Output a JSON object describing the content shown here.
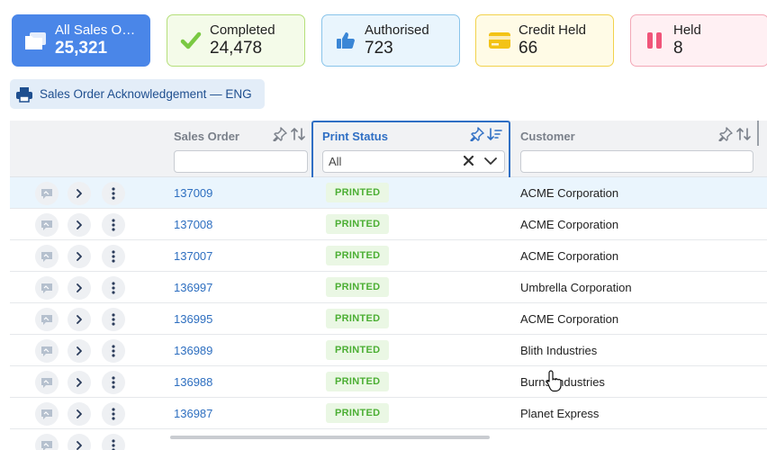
{
  "cards": [
    {
      "id": "all",
      "label": "All Sales Or…",
      "count": "25,321",
      "icon": "folders-icon"
    },
    {
      "id": "completed",
      "label": "Completed",
      "count": "24,478",
      "icon": "check-icon"
    },
    {
      "id": "authorised",
      "label": "Authorised",
      "count": "723",
      "icon": "thumbs-up-icon"
    },
    {
      "id": "credit",
      "label": "Credit Held",
      "count": "66",
      "icon": "credit-card-icon"
    },
    {
      "id": "held",
      "label": "Held",
      "count": "8",
      "icon": "pause-icon"
    }
  ],
  "print_button": {
    "label": "Sales Order Acknowledgement — ENG",
    "icon": "printer-icon"
  },
  "columns": {
    "sales_order": {
      "title": "Sales Order",
      "filter_value": ""
    },
    "print_status": {
      "title": "Print Status",
      "filter_value": "All"
    },
    "customer": {
      "title": "Customer",
      "filter_value": ""
    }
  },
  "rows": [
    {
      "so": "137009",
      "status": "PRINTED",
      "customer": "ACME Corporation"
    },
    {
      "so": "137008",
      "status": "PRINTED",
      "customer": "ACME Corporation"
    },
    {
      "so": "137007",
      "status": "PRINTED",
      "customer": "ACME Corporation"
    },
    {
      "so": "136997",
      "status": "PRINTED",
      "customer": "Umbrella Corporation"
    },
    {
      "so": "136995",
      "status": "PRINTED",
      "customer": "ACME Corporation"
    },
    {
      "so": "136989",
      "status": "PRINTED",
      "customer": "Blith Industries"
    },
    {
      "so": "136988",
      "status": "PRINTED",
      "customer": "Burns Industries"
    },
    {
      "so": "136987",
      "status": "PRINTED",
      "customer": "Planet Express"
    }
  ],
  "colors": {
    "accent": "#4a86e8",
    "link": "#2e6fc0",
    "printed_badge_bg": "#eaf7e4",
    "printed_badge_text": "#4caf34",
    "selected_row": "#eaf5fd"
  }
}
